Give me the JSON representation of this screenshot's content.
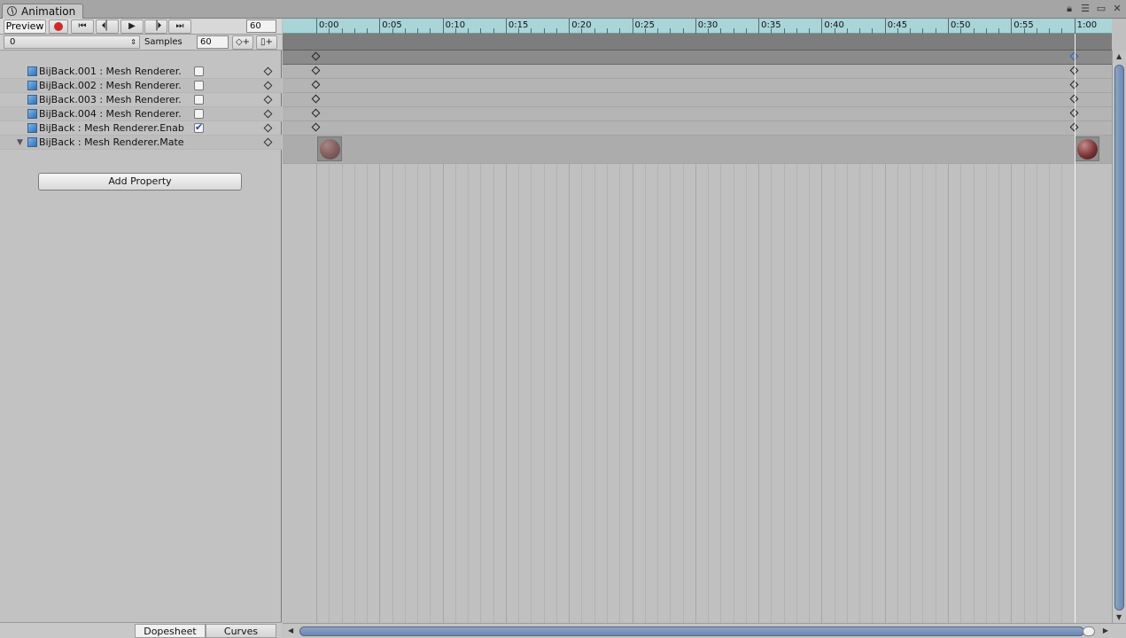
{
  "window": {
    "tab_title": "Animation",
    "controls": [
      "lock-icon",
      "menu-icon",
      "maximize-icon",
      "close-icon"
    ]
  },
  "toolbar": {
    "preview_label": "Preview",
    "record_icon": "record-icon",
    "first_key_icon": "first-key-icon",
    "prev_key_icon": "prev-key-icon",
    "play_icon": "play-icon",
    "next_key_icon": "next-key-icon",
    "last_key_icon": "last-key-icon",
    "frame_value": "60",
    "clip_value": "0",
    "samples_label": "Samples",
    "samples_value": "60",
    "add_key_icon": "add-keyframe-icon",
    "add_event_icon": "add-event-icon"
  },
  "properties": [
    {
      "label": "BijBack.001 : Mesh Renderer.",
      "checked": false,
      "has_check": true,
      "expandable": false
    },
    {
      "label": "BijBack.002 : Mesh Renderer.",
      "checked": false,
      "has_check": true,
      "expandable": false
    },
    {
      "label": "BijBack.003 : Mesh Renderer.",
      "checked": false,
      "has_check": true,
      "expandable": false
    },
    {
      "label": "BijBack.004 : Mesh Renderer.",
      "checked": false,
      "has_check": true,
      "expandable": false
    },
    {
      "label": "BijBack : Mesh Renderer.Enab",
      "checked": true,
      "has_check": true,
      "expandable": false
    },
    {
      "label": "BijBack : Mesh Renderer.Mate",
      "checked": false,
      "has_check": false,
      "expandable": true
    }
  ],
  "add_property_label": "Add Property",
  "bottom_tabs": {
    "dopesheet": "Dopesheet",
    "curves": "Curves",
    "active": "Dopesheet"
  },
  "ruler": {
    "labels": [
      "0:00",
      "0:05",
      "0:10",
      "0:15",
      "0:20",
      "0:25",
      "0:30",
      "0:35",
      "0:40",
      "0:45",
      "0:50",
      "0:55",
      "1:00"
    ]
  },
  "timeline": {
    "keyframe_times": [
      "0:00",
      "1:00"
    ],
    "playhead_time": "1:00",
    "material_thumbnails": [
      "sphere-material-preview",
      "sphere-material-preview"
    ]
  },
  "colors": {
    "ruler_bg": "#a9d4d8",
    "record": "#cf2a2a",
    "selected_key": "#2a62c8",
    "scrollbar": "#6b86b2"
  }
}
